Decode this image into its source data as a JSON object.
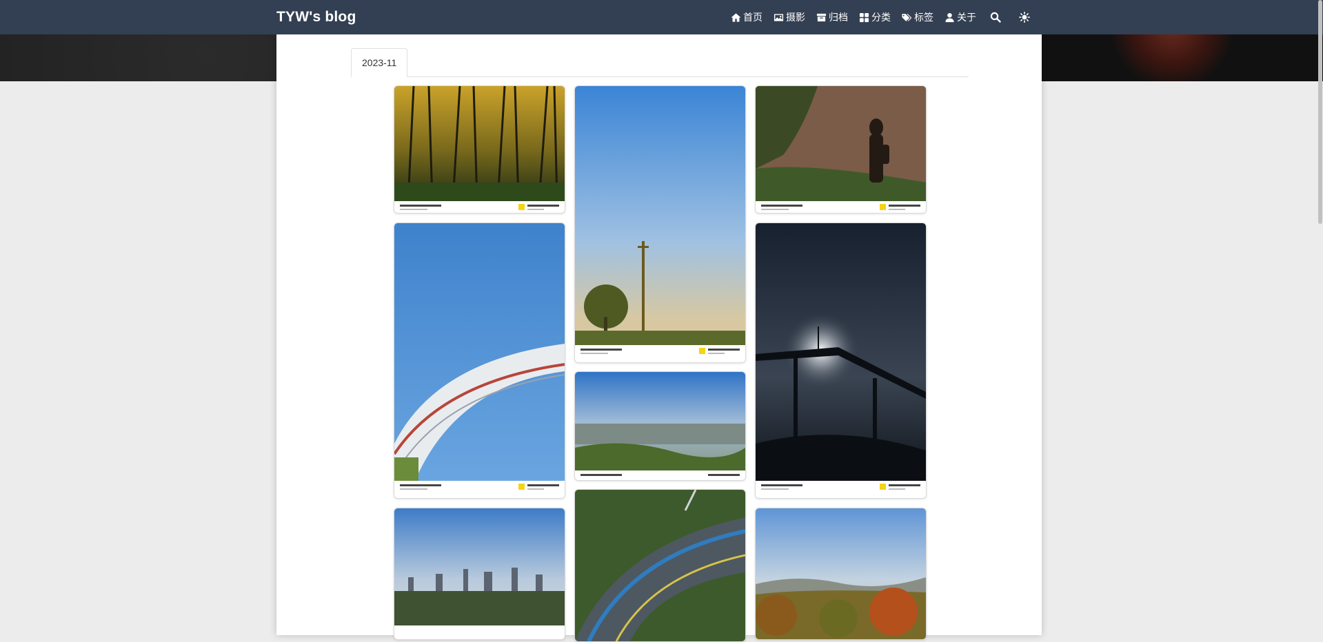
{
  "brand": "TYW's blog",
  "nav": [
    {
      "label": "首页",
      "icon": "home-icon"
    },
    {
      "label": "摄影",
      "icon": "image-icon"
    },
    {
      "label": "归档",
      "icon": "archive-icon"
    },
    {
      "label": "分类",
      "icon": "grid-icon"
    },
    {
      "label": "标签",
      "icon": "tags-icon"
    },
    {
      "label": "关于",
      "icon": "user-icon"
    }
  ],
  "tools": [
    {
      "icon": "search-icon"
    },
    {
      "icon": "sun-icon"
    }
  ],
  "tabs": [
    {
      "label": "2023-11",
      "active": true
    }
  ],
  "colors": {
    "navbar": "#333f52",
    "page_background": "#ececec",
    "content_background": "#ffffff"
  },
  "photos": [
    {
      "name": "bamboo-forest-photo"
    },
    {
      "name": "pole-and-tree-photo"
    },
    {
      "name": "silhouette-on-cliff-photo"
    },
    {
      "name": "sky-bridge-arch-photo"
    },
    {
      "name": "city-valley-view-photo"
    },
    {
      "name": "walkway-at-night-photo"
    },
    {
      "name": "city-skyline-photo"
    },
    {
      "name": "curved-road-photo"
    },
    {
      "name": "autumn-hills-photo"
    }
  ]
}
